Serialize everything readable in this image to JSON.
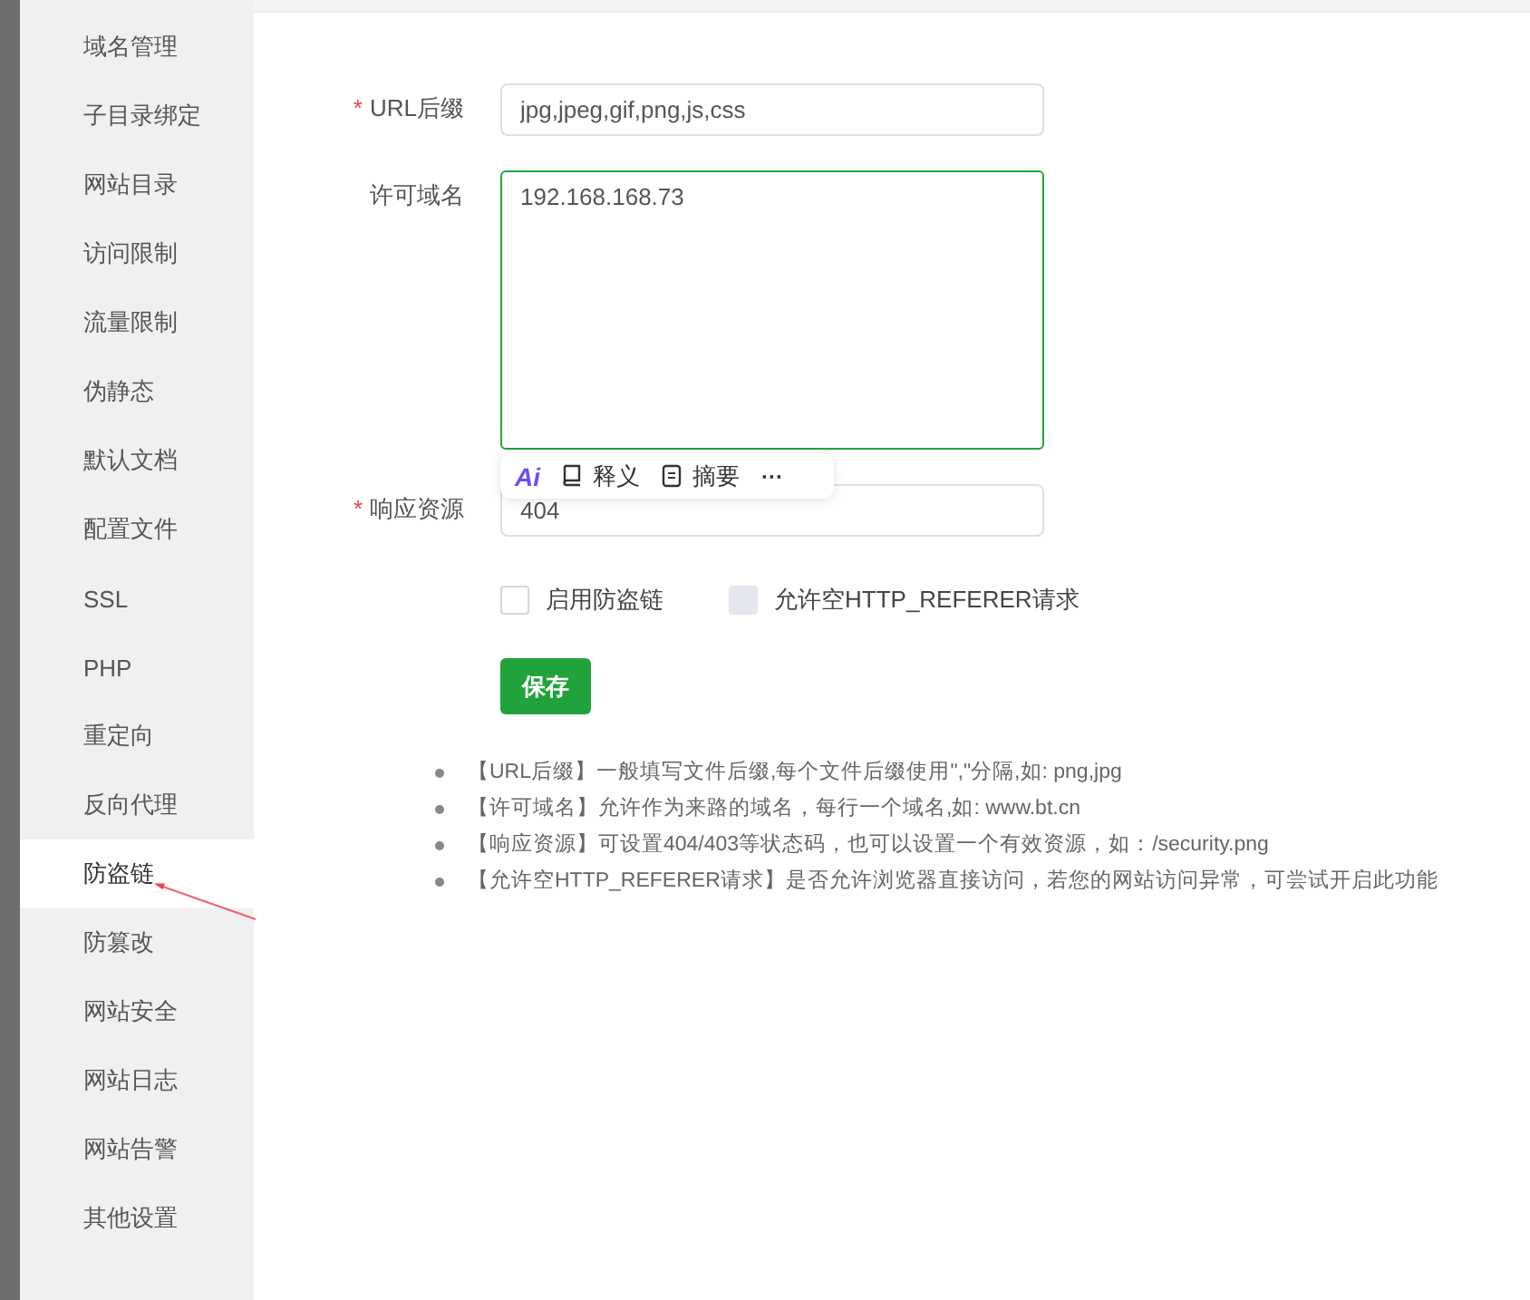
{
  "sidebar": {
    "items": [
      {
        "label": "域名管理",
        "selected": false
      },
      {
        "label": "子目录绑定",
        "selected": false
      },
      {
        "label": "网站目录",
        "selected": false
      },
      {
        "label": "访问限制",
        "selected": false
      },
      {
        "label": "流量限制",
        "selected": false
      },
      {
        "label": "伪静态",
        "selected": false
      },
      {
        "label": "默认文档",
        "selected": false
      },
      {
        "label": "配置文件",
        "selected": false
      },
      {
        "label": "SSL",
        "selected": false
      },
      {
        "label": "PHP",
        "selected": false
      },
      {
        "label": "重定向",
        "selected": false
      },
      {
        "label": "反向代理",
        "selected": false
      },
      {
        "label": "防盗链",
        "selected": true
      },
      {
        "label": "防篡改",
        "selected": false
      },
      {
        "label": "网站安全",
        "selected": false
      },
      {
        "label": "网站日志",
        "selected": false
      },
      {
        "label": "网站告警",
        "selected": false
      },
      {
        "label": "其他设置",
        "selected": false
      }
    ]
  },
  "form": {
    "fields": [
      {
        "kind": "input",
        "label": "URL后缀",
        "required": true,
        "value": "jpg,jpeg,gif,png,js,css"
      },
      {
        "kind": "textarea",
        "label": "许可域名",
        "required": false,
        "value": "192.168.168.73"
      },
      {
        "kind": "input",
        "label": "响应资源",
        "required": true,
        "value": "404"
      }
    ],
    "checkboxes": [
      {
        "label": "启用防盗链",
        "checked": false,
        "disabled": false
      },
      {
        "label": "允许空HTTP_REFERER请求",
        "checked": false,
        "disabled": true
      }
    ],
    "save_button": "保存",
    "required_mark": "*"
  },
  "ai_toolbar": {
    "logo": "Ai",
    "items": [
      {
        "kind": "book",
        "label": "释义"
      },
      {
        "kind": "doc",
        "label": "摘要"
      }
    ],
    "more": "···"
  },
  "notes": [
    "【URL后缀】一般填写文件后缀,每个文件后缀使用\",\"分隔,如: png,jpg",
    "【许可域名】允许作为来路的域名，每行一个域名,如: www.bt.cn",
    "【响应资源】可设置404/403等状态码，也可以设置一个有效资源，如：/security.png",
    "【允许空HTTP_REFERER请求】是否允许浏览器直接访问，若您的网站访问异常，可尝试开启此功能"
  ]
}
